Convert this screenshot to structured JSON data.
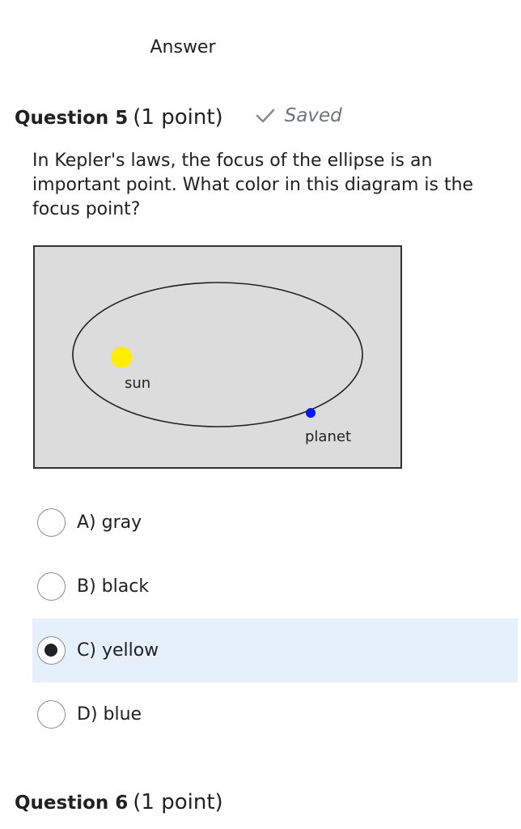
{
  "section": {
    "heading": "Answer"
  },
  "question5": {
    "title": "Question 5",
    "points": "(1 point)",
    "status": "Saved",
    "status_icon": "check-icon",
    "text": "In Kepler's laws, the focus of the ellipse is an important point. What color in this diagram is the focus point?",
    "diagram": {
      "sun_label": "sun",
      "planet_label": "planet",
      "colors": {
        "background": "#dcdcdc",
        "sun": "#ffee00",
        "planet": "#0018ff",
        "orbit": "#202020"
      }
    },
    "choices": [
      {
        "label": "A) gray",
        "selected": false
      },
      {
        "label": "B) black",
        "selected": false
      },
      {
        "label": "C) yellow",
        "selected": true
      },
      {
        "label": "D) blue",
        "selected": false
      }
    ]
  },
  "question6": {
    "title": "Question 6",
    "points": "(1 point)"
  },
  "colors": {
    "selected_background": "#e6f0fb",
    "text": "#202122",
    "muted": "#6e7376"
  }
}
